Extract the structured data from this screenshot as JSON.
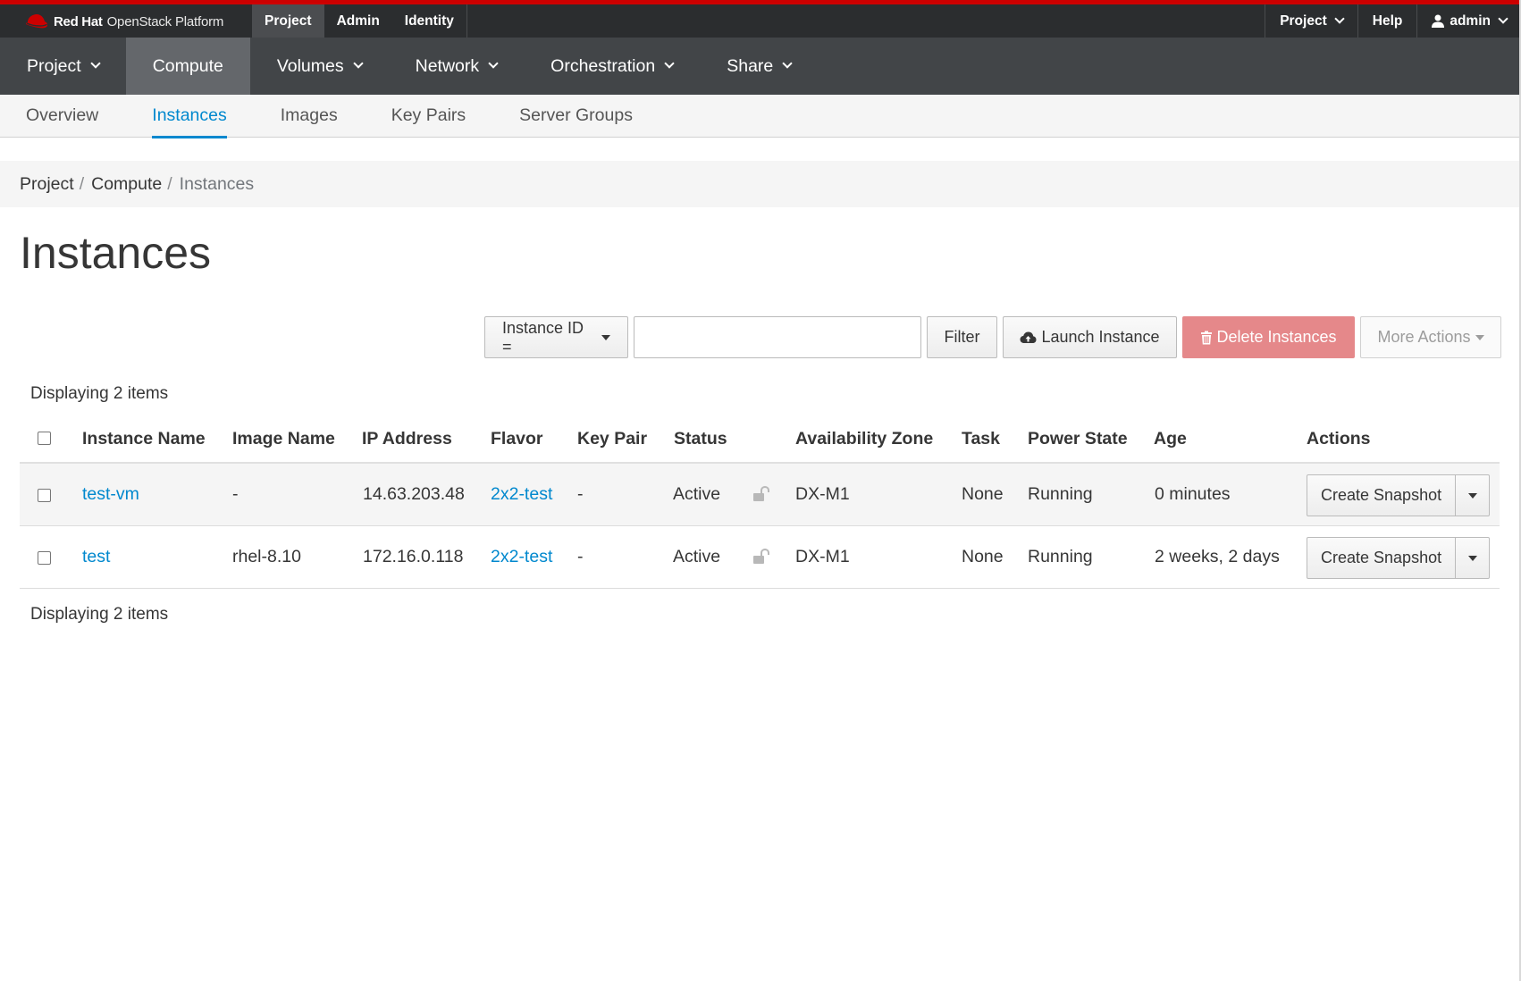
{
  "masthead": {
    "brand_strong": "Red Hat",
    "brand_rest": "OpenStack Platform",
    "tabs": [
      {
        "label": "Project",
        "active": true
      },
      {
        "label": "Admin",
        "active": false
      },
      {
        "label": "Identity",
        "active": false
      }
    ],
    "right": {
      "project_menu": "Project",
      "help": "Help",
      "user": "admin"
    },
    "accent_color": "#cc0000"
  },
  "mainnav": {
    "items": [
      {
        "label": "Project",
        "active": false,
        "dropdown": true
      },
      {
        "label": "Compute",
        "active": true,
        "dropdown": false
      },
      {
        "label": "Volumes",
        "active": false,
        "dropdown": true
      },
      {
        "label": "Network",
        "active": false,
        "dropdown": true
      },
      {
        "label": "Orchestration",
        "active": false,
        "dropdown": true
      },
      {
        "label": "Share",
        "active": false,
        "dropdown": true
      }
    ]
  },
  "subnav": {
    "tabs": [
      {
        "label": "Overview",
        "active": false
      },
      {
        "label": "Instances",
        "active": true
      },
      {
        "label": "Images",
        "active": false
      },
      {
        "label": "Key Pairs",
        "active": false
      },
      {
        "label": "Server Groups",
        "active": false
      }
    ]
  },
  "breadcrumb": {
    "items": [
      "Project",
      "Compute",
      "Instances"
    ],
    "separator": "/"
  },
  "page_title": "Instances",
  "toolbar": {
    "filter_field": "Instance ID =",
    "search_value": "",
    "filter_label": "Filter",
    "launch_label": "Launch Instance",
    "delete_label": "Delete Instances",
    "more_label": "More Actions"
  },
  "table": {
    "count_top": "Displaying 2 items",
    "count_bottom": "Displaying 2 items",
    "columns": [
      "Instance Name",
      "Image Name",
      "IP Address",
      "Flavor",
      "Key Pair",
      "Status",
      "Availability Zone",
      "Task",
      "Power State",
      "Age",
      "Actions"
    ],
    "rows": [
      {
        "name": "test-vm",
        "image": "-",
        "ip": "14.63.203.48",
        "flavor": "2x2-test",
        "keypair": "-",
        "status": "Active",
        "zone": "DX-M1",
        "task": "None",
        "power": "Running",
        "age": "0 minutes",
        "action": "Create Snapshot"
      },
      {
        "name": "test",
        "image": "rhel-8.10",
        "ip": "172.16.0.118",
        "flavor": "2x2-test",
        "keypair": "-",
        "status": "Active",
        "zone": "DX-M1",
        "task": "None",
        "power": "Running",
        "age": "2 weeks, 2 days",
        "action": "Create Snapshot"
      }
    ]
  },
  "colors": {
    "link": "#0088ce",
    "danger_button": "#e5888a"
  }
}
